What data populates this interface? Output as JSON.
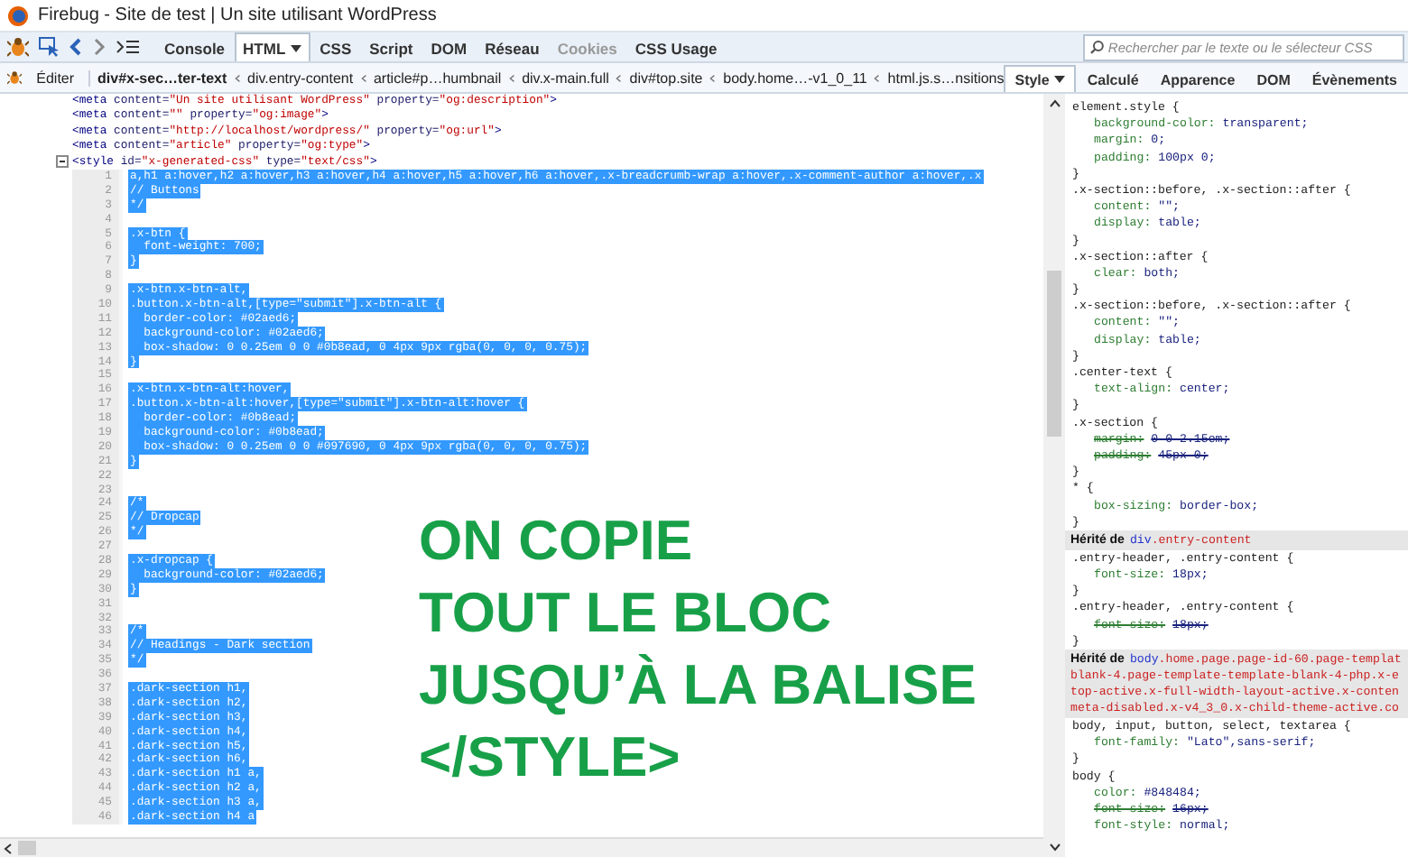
{
  "window": {
    "title": "Firebug - Site de test | Un site utilisant WordPress"
  },
  "toolbar": {
    "tabs": [
      {
        "label": "Console",
        "selected": false,
        "disabled": false,
        "menu": false
      },
      {
        "label": "HTML",
        "selected": true,
        "disabled": false,
        "menu": true
      },
      {
        "label": "CSS",
        "selected": false,
        "disabled": false,
        "menu": false
      },
      {
        "label": "Script",
        "selected": false,
        "disabled": false,
        "menu": false
      },
      {
        "label": "DOM",
        "selected": false,
        "disabled": false,
        "menu": false
      },
      {
        "label": "Réseau",
        "selected": false,
        "disabled": false,
        "menu": false
      },
      {
        "label": "Cookies",
        "selected": false,
        "disabled": true,
        "menu": false
      },
      {
        "label": "CSS Usage",
        "selected": false,
        "disabled": false,
        "menu": false
      }
    ],
    "search": {
      "placeholder": "Rechercher par le texte ou le sélecteur CSS"
    }
  },
  "breadcrumb": {
    "edit_button": "Éditer",
    "items": [
      {
        "label": "div#x-sec…ter-text",
        "selected": true
      },
      {
        "label": "div.entry-content",
        "selected": false
      },
      {
        "label": "article#p…humbnail",
        "selected": false
      },
      {
        "label": "div.x-main.full",
        "selected": false
      },
      {
        "label": "div#top.site",
        "selected": false
      },
      {
        "label": "body.home…-v1_0_11",
        "selected": false
      },
      {
        "label": "html.js.s…nsitions",
        "selected": false
      }
    ]
  },
  "side_tabs": [
    {
      "label": "Style",
      "selected": true,
      "menu": true
    },
    {
      "label": "Calculé",
      "selected": false,
      "menu": false
    },
    {
      "label": "Apparence",
      "selected": false,
      "menu": false
    },
    {
      "label": "DOM",
      "selected": false,
      "menu": false
    },
    {
      "label": "Évènements",
      "selected": false,
      "menu": false
    }
  ],
  "html_lines": [
    {
      "segments": [
        {
          "kind": "tag",
          "text": "<meta"
        },
        {
          "kind": "attr",
          "text": " content="
        },
        {
          "kind": "value",
          "text": "\"Un site utilisant WordPress\""
        },
        {
          "kind": "attr",
          "text": " property="
        },
        {
          "kind": "value",
          "text": "\"og:description\""
        },
        {
          "kind": "tag",
          "text": ">"
        }
      ]
    },
    {
      "segments": [
        {
          "kind": "tag",
          "text": "<meta"
        },
        {
          "kind": "attr",
          "text": " content="
        },
        {
          "kind": "value",
          "text": "\"\""
        },
        {
          "kind": "attr",
          "text": " property="
        },
        {
          "kind": "value",
          "text": "\"og:image\""
        },
        {
          "kind": "tag",
          "text": ">"
        }
      ]
    },
    {
      "segments": [
        {
          "kind": "tag",
          "text": "<meta"
        },
        {
          "kind": "attr",
          "text": " content="
        },
        {
          "kind": "value",
          "text": "\"http://localhost/wordpress/\""
        },
        {
          "kind": "attr",
          "text": " property="
        },
        {
          "kind": "value",
          "text": "\"og:url\""
        },
        {
          "kind": "tag",
          "text": ">"
        }
      ]
    },
    {
      "segments": [
        {
          "kind": "tag",
          "text": "<meta"
        },
        {
          "kind": "attr",
          "text": " content="
        },
        {
          "kind": "value",
          "text": "\"article\""
        },
        {
          "kind": "attr",
          "text": " property="
        },
        {
          "kind": "value",
          "text": "\"og:type\""
        },
        {
          "kind": "tag",
          "text": ">"
        }
      ]
    }
  ],
  "style_tag": {
    "expanded": true,
    "segments": [
      {
        "kind": "tag",
        "text": "<style"
      },
      {
        "kind": "attr",
        "text": " id="
      },
      {
        "kind": "value",
        "text": "\"x-generated-css\""
      },
      {
        "kind": "attr",
        "text": " type="
      },
      {
        "kind": "value",
        "text": "\"text/css\""
      },
      {
        "kind": "tag",
        "text": ">"
      }
    ]
  },
  "code_lines": [
    {
      "number": "1",
      "text": "a,h1 a:hover,h2 a:hover,h3 a:hover,h4 a:hover,h5 a:hover,h6 a:hover,.x-breadcrumb-wrap a:hover,.x-comment-author a:hover,.x",
      "selected": true
    },
    {
      "number": "2",
      "text": "// Buttons",
      "selected": true
    },
    {
      "number": "3",
      "text": "*/",
      "selected": true
    },
    {
      "number": "4"
    },
    {
      "number": "5",
      "text": ".x-btn {",
      "selected": true
    },
    {
      "number": "6",
      "text": "  font-weight: 700;",
      "selected": true
    },
    {
      "number": "7",
      "text": "}",
      "selected": true
    },
    {
      "number": "8"
    },
    {
      "number": "9",
      "text": ".x-btn.x-btn-alt,",
      "selected": true
    },
    {
      "number": "10",
      "text": ".button.x-btn-alt,[type=\"submit\"].x-btn-alt {",
      "selected": true
    },
    {
      "number": "11",
      "text": "  border-color: #02aed6;",
      "selected": true
    },
    {
      "number": "12",
      "text": "  background-color: #02aed6;",
      "selected": true
    },
    {
      "number": "13",
      "text": "  box-shadow: 0 0.25em 0 0 #0b8ead, 0 4px 9px rgba(0, 0, 0, 0.75);",
      "selected": true
    },
    {
      "number": "14",
      "text": "}",
      "selected": true
    },
    {
      "number": "15"
    },
    {
      "number": "16",
      "text": ".x-btn.x-btn-alt:hover,",
      "selected": true
    },
    {
      "number": "17",
      "text": ".button.x-btn-alt:hover,[type=\"submit\"].x-btn-alt:hover {",
      "selected": true
    },
    {
      "number": "18",
      "text": "  border-color: #0b8ead;",
      "selected": true
    },
    {
      "number": "19",
      "text": "  background-color: #0b8ead;",
      "selected": true
    },
    {
      "number": "20",
      "text": "  box-shadow: 0 0.25em 0 0 #097690, 0 4px 9px rgba(0, 0, 0, 0.75);",
      "selected": true
    },
    {
      "number": "21",
      "text": "}",
      "selected": true
    },
    {
      "number": "22"
    },
    {
      "number": "23"
    },
    {
      "number": "24",
      "text": "/*",
      "selected": true
    },
    {
      "number": "25",
      "text": "// Dropcap",
      "selected": true
    },
    {
      "number": "26",
      "text": "*/",
      "selected": true
    },
    {
      "number": "27"
    },
    {
      "number": "28",
      "text": ".x-dropcap {",
      "selected": true
    },
    {
      "number": "29",
      "text": "  background-color: #02aed6;",
      "selected": true
    },
    {
      "number": "30",
      "text": "}",
      "selected": true
    },
    {
      "number": "31"
    },
    {
      "number": "32"
    },
    {
      "number": "33",
      "text": "/*",
      "selected": true
    },
    {
      "number": "34",
      "text": "// Headings - Dark section",
      "selected": true
    },
    {
      "number": "35",
      "text": "*/",
      "selected": true
    },
    {
      "number": "36"
    },
    {
      "number": "37",
      "text": ".dark-section h1,",
      "selected": true
    },
    {
      "number": "38",
      "text": ".dark-section h2,",
      "selected": true
    },
    {
      "number": "39",
      "text": ".dark-section h3,",
      "selected": true
    },
    {
      "number": "40",
      "text": ".dark-section h4,",
      "selected": true
    },
    {
      "number": "41",
      "text": ".dark-section h5,",
      "selected": true
    },
    {
      "number": "42",
      "text": ".dark-section h6,",
      "selected": true
    },
    {
      "number": "43",
      "text": ".dark-section h1 a,",
      "selected": true
    },
    {
      "number": "44",
      "text": ".dark-section h2 a,",
      "selected": true
    },
    {
      "number": "45",
      "text": ".dark-section h3 a,",
      "selected": true
    },
    {
      "number": "46",
      "text": ".dark-section h4 a",
      "selected": true
    }
  ],
  "annotation": {
    "lines": [
      "ON COPIE",
      "TOUT LE BLOC",
      "JUSQU’À LA BALISE",
      "</STYLE>"
    ]
  },
  "style_panel": [
    {
      "kind": "rule",
      "selector": "element.style {",
      "declarations": [
        {
          "prop": "background-color:",
          "value": "transparent;",
          "overridden": false
        },
        {
          "prop": "margin:",
          "value": "0;",
          "overridden": false
        },
        {
          "prop": "padding:",
          "value": "100px 0;",
          "overridden": false
        }
      ],
      "close": "}"
    },
    {
      "kind": "rule",
      "selector": ".x-section::before, .x-section::after {",
      "declarations": [
        {
          "prop": "content:",
          "value": "\"\";",
          "overridden": false
        },
        {
          "prop": "display:",
          "value": "table;",
          "overridden": false
        }
      ],
      "close": "}"
    },
    {
      "kind": "rule",
      "selector": ".x-section::after {",
      "declarations": [
        {
          "prop": "clear:",
          "value": "both;",
          "overridden": false
        }
      ],
      "close": "}"
    },
    {
      "kind": "rule",
      "selector": ".x-section::before, .x-section::after {",
      "declarations": [
        {
          "prop": "content:",
          "value": "\"\";",
          "overridden": false
        },
        {
          "prop": "display:",
          "value": "table;",
          "overridden": false
        }
      ],
      "close": "}"
    },
    {
      "kind": "rule",
      "selector": ".center-text {",
      "declarations": [
        {
          "prop": "text-align:",
          "value": "center;",
          "overridden": false
        }
      ],
      "close": "}"
    },
    {
      "kind": "rule",
      "selector": ".x-section {",
      "declarations": [
        {
          "prop": "margin:",
          "value": "0 0 2.15em;",
          "overridden": true
        },
        {
          "prop": "padding:",
          "value": "45px 0;",
          "overridden": true
        }
      ],
      "close": "}"
    },
    {
      "kind": "rule",
      "selector": "* {",
      "declarations": [
        {
          "prop": "box-sizing:",
          "value": "border-box;",
          "overridden": false
        }
      ],
      "close": "}"
    },
    {
      "kind": "inherited",
      "label": "Hérité de",
      "element": "div",
      "lines": [
        ".entry-content"
      ]
    },
    {
      "kind": "rule",
      "selector": ".entry-header, .entry-content {",
      "declarations": [
        {
          "prop": "font-size:",
          "value": "18px;",
          "overridden": false
        }
      ],
      "close": "}"
    },
    {
      "kind": "rule",
      "selector": ".entry-header, .entry-content {",
      "declarations": [
        {
          "prop": "font-size:",
          "value": "18px;",
          "overridden": true
        }
      ],
      "close": "}"
    },
    {
      "kind": "inherited",
      "label": "Hérité de",
      "element": "body",
      "lines": [
        ".home.page.page-id-60.page-templat",
        "blank-4.page-template-template-blank-4-php.x-e",
        "top-active.x-full-width-layout-active.x-conten",
        "meta-disabled.x-v4_3_0.x-child-theme-active.co"
      ]
    },
    {
      "kind": "rule",
      "selector": "body, input, button, select, textarea {",
      "declarations": [
        {
          "prop": "font-family:",
          "value": "\"Lato\",sans-serif;",
          "overridden": false
        }
      ],
      "close": "}"
    },
    {
      "kind": "rule",
      "selector": "body {",
      "declarations": [
        {
          "prop": "color:",
          "value": "#848484;",
          "overridden": false
        },
        {
          "prop": "font-size:",
          "value": "16px;",
          "overridden": true
        },
        {
          "prop": "font-style:",
          "value": "normal;",
          "overridden": false
        }
      ]
    }
  ]
}
